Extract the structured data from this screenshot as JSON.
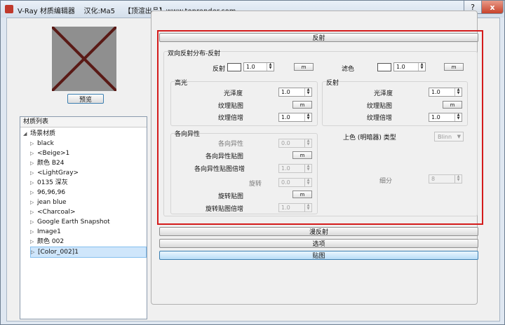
{
  "window": {
    "title": "V-Ray 材质编辑器    汉化:Ma5    【顶渲出品】www.toprender.com",
    "help_label": "?",
    "close_label": "x"
  },
  "left": {
    "preview_button": "预览",
    "list_header": "材质列表",
    "root": "场景材质",
    "items": [
      "black",
      "<Beige>1",
      "颜色 B24",
      "<LightGray>",
      "0135 深灰",
      "96,96,96",
      "jean blue",
      "<Charcoal>",
      "Google Earth Snapshot",
      "Image1",
      "颜色 002",
      "[Color_002]1"
    ]
  },
  "sections": {
    "reflection": "反射",
    "diffuse": "漫反射",
    "options": "选项",
    "maps": "贴图"
  },
  "brdf": {
    "title": "双向反射分布-反射",
    "reflect_label": "反射",
    "reflect_value": "1.0",
    "filter_label": "滤色",
    "filter_value": "1.0",
    "map_button": "m"
  },
  "highlight": {
    "title": "高光",
    "gloss_label": "光泽度",
    "gloss_value": "1.0",
    "map_label": "纹理贴图",
    "mult_label": "纹理倍增",
    "mult_value": "1.0"
  },
  "refl_group": {
    "title": "反射",
    "gloss_label": "光泽度",
    "gloss_value": "1.0",
    "map_label": "纹理贴图",
    "mult_label": "纹理倍增",
    "mult_value": "1.0"
  },
  "aniso": {
    "title": "各向异性",
    "aniso_label": "各向异性",
    "aniso_value": "0.0",
    "aniso_map_label": "各向异性贴图",
    "aniso_mult_label": "各向异性贴图倍增",
    "aniso_mult_value": "1.0",
    "rot_label": "旋转",
    "rot_value": "0.0",
    "rot_map_label": "旋转贴图",
    "rot_mult_label": "旋转贴图倍增",
    "rot_mult_value": "1.0"
  },
  "shader": {
    "type_label": "上色 (明暗器) 类型",
    "type_value": "Blinn",
    "subdiv_label": "细分",
    "subdiv_value": "8"
  },
  "colors": {
    "red_frame": "#d41b1b",
    "preview_bg": "#8f8f8f",
    "preview_cross": "#5a1a16"
  }
}
